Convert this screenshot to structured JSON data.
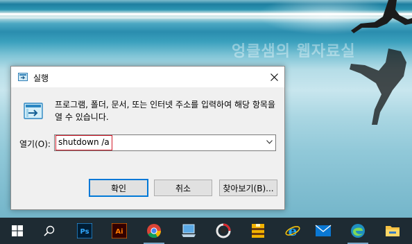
{
  "desktop": {
    "watermark": "엉클샘의 웹자료실"
  },
  "dialog": {
    "title": "실행",
    "description": "프로그램, 폴더, 문서, 또는 인터넷 주소를 입력하여 해당 항목을 열 수 있습니다.",
    "open_label": "열기(O):",
    "command_value": "shutdown /a",
    "ok_label": "확인",
    "cancel_label": "취소",
    "browse_label": "찾아보기(B)..."
  },
  "taskbar": {
    "items": [
      {
        "icon": "windows-start-icon"
      },
      {
        "icon": "search-icon"
      },
      {
        "icon": "photoshop-icon",
        "text": "Ps"
      },
      {
        "icon": "illustrator-icon",
        "text": "Ai"
      },
      {
        "icon": "chrome-icon"
      },
      {
        "icon": "computer-icon"
      },
      {
        "icon": "circle-app-icon"
      },
      {
        "icon": "archive-app-icon"
      },
      {
        "icon": "internet-explorer-icon"
      },
      {
        "icon": "mail-icon"
      },
      {
        "icon": "edge-icon"
      },
      {
        "icon": "file-explorer-icon"
      }
    ]
  },
  "colors": {
    "taskbar": "#1e2b33",
    "highlight_border": "#d11a2a",
    "default_button_border": "#0078d7"
  }
}
